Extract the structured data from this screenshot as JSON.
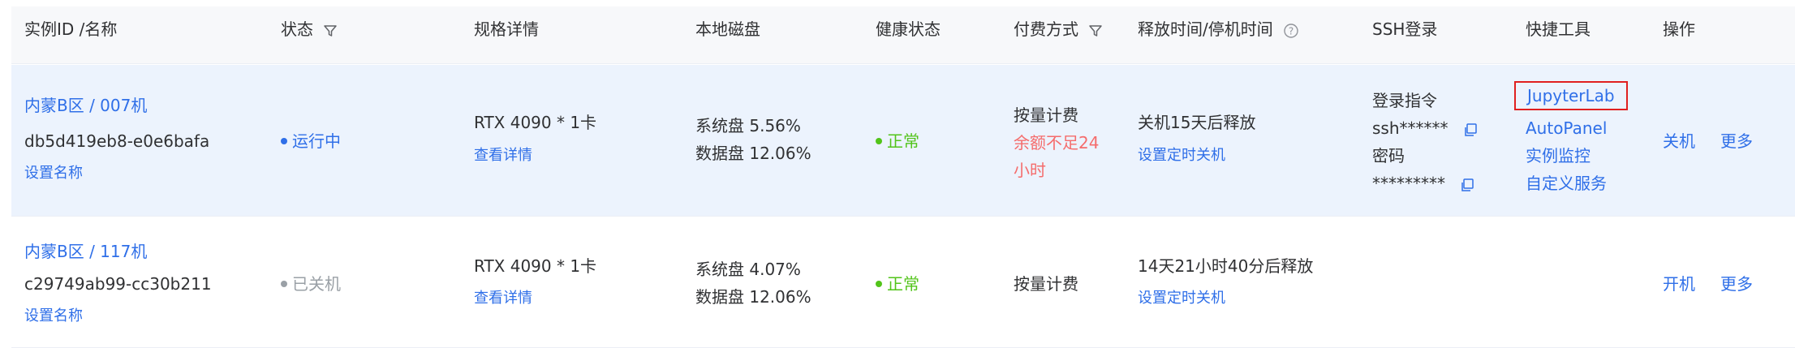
{
  "header": {
    "col_instance": "实例ID /名称",
    "col_status": "状态",
    "col_spec": "规格详情",
    "col_disk": "本地磁盘",
    "col_health": "健康状态",
    "col_billing": "付费方式",
    "col_release": "释放时间/停机时间",
    "col_ssh": "SSH登录",
    "col_tools": "快捷工具",
    "col_ops": "操作"
  },
  "rows": [
    {
      "region_name": "内蒙B区 / 007机",
      "instance_id": "db5d419eb8-e0e6bafa",
      "set_name": "设置名称",
      "status": "运行中",
      "spec": "RTX 4090 * 1卡",
      "spec_detail": "查看详情",
      "sys_disk": "系统盘 5.56%",
      "data_disk": "数据盘 12.06%",
      "health": "正常",
      "billing": "按量计费",
      "billing_warn_1": "余额不足24",
      "billing_warn_2": "小时",
      "release": "关机15天后释放",
      "set_shutdown": "设置定时关机",
      "ssh_cmd_label": "登录指令",
      "ssh_cmd_value": "ssh******",
      "ssh_pwd_label": "密码",
      "ssh_pwd_value": "*********",
      "tool_jupyter": "JupyterLab",
      "tool_autopanel": "AutoPanel",
      "tool_monitor": "实例监控",
      "tool_custom": "自定义服务",
      "op_primary": "关机",
      "op_more": "更多"
    },
    {
      "region_name": "内蒙B区 / 117机",
      "instance_id": "c29749ab99-cc30b211",
      "set_name": "设置名称",
      "status": "已关机",
      "spec": "RTX 4090 * 1卡",
      "spec_detail": "查看详情",
      "sys_disk": "系统盘 4.07%",
      "data_disk": "数据盘 12.06%",
      "health": "正常",
      "billing": "按量计费",
      "release": "14天21小时40分后释放",
      "set_shutdown": "设置定时关机",
      "op_primary": "开机",
      "op_more": "更多"
    }
  ],
  "colors": {
    "link": "#2f6fe8",
    "running": "#2f6fe8",
    "stopped": "#9aa0a6",
    "healthy": "#52c41a",
    "warning": "#f56c6c",
    "highlight_border": "#e02020",
    "selected_row_bg": "#ecf3fd"
  },
  "icons": {
    "status_filter": "filter-icon",
    "billing_filter": "filter-icon",
    "release_help": "question-circle-icon",
    "copy": "copy-icon"
  }
}
